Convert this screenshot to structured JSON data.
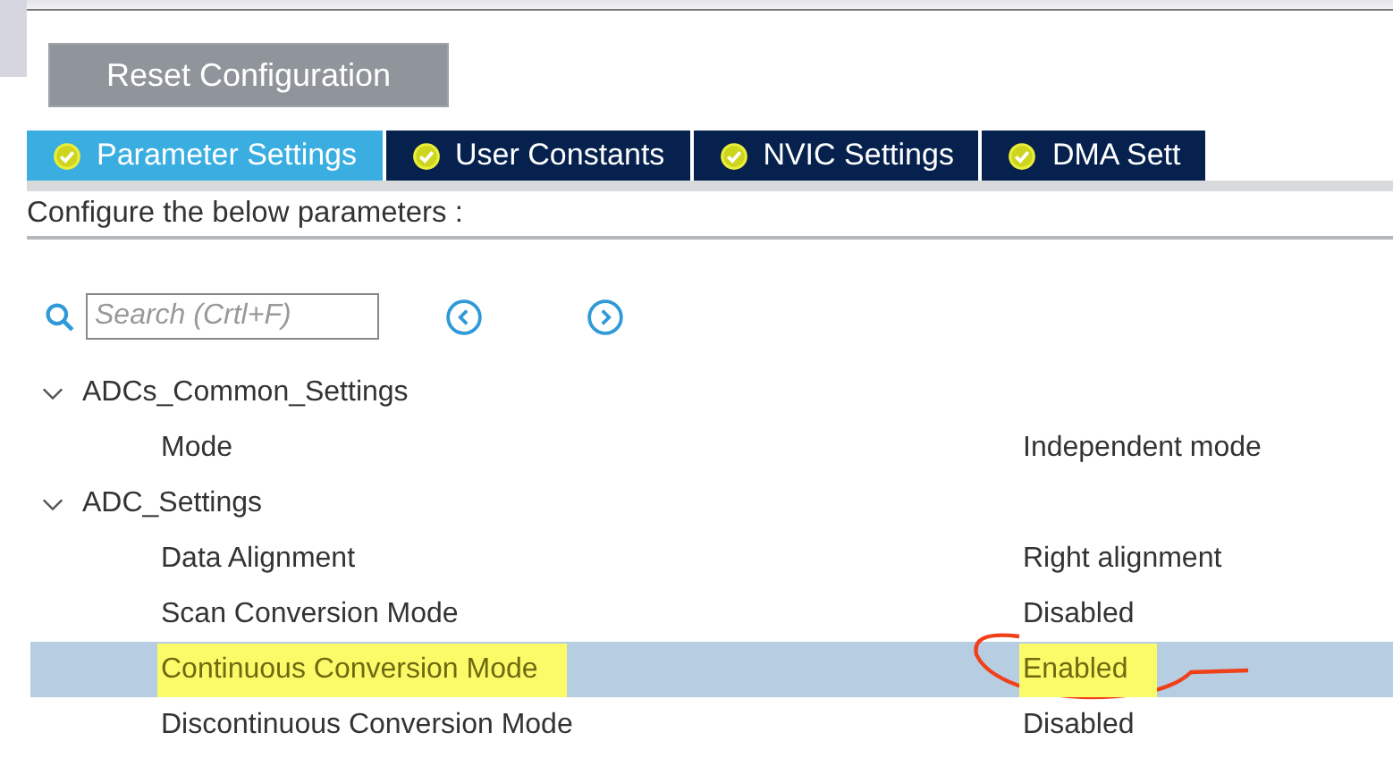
{
  "reset_button": {
    "label": "Reset Configuration"
  },
  "tabs": [
    {
      "label": "Parameter Settings",
      "selected": true
    },
    {
      "label": "User Constants",
      "selected": false
    },
    {
      "label": "NVIC Settings",
      "selected": false
    },
    {
      "label": "DMA Sett",
      "selected": false
    }
  ],
  "caption": "Configure the below parameters :",
  "search": {
    "placeholder": "Search (Crtl+F)"
  },
  "tree": [
    {
      "label": "ADCs_Common_Settings",
      "expanded": true,
      "children": [
        {
          "label": "Mode",
          "value": "Independent mode",
          "selected": false,
          "highlighted": false,
          "circled": false
        }
      ]
    },
    {
      "label": "ADC_Settings",
      "expanded": true,
      "children": [
        {
          "label": "Data Alignment",
          "value": "Right alignment",
          "selected": false,
          "highlighted": false,
          "circled": false
        },
        {
          "label": "Scan Conversion Mode",
          "value": "Disabled",
          "selected": false,
          "highlighted": false,
          "circled": false
        },
        {
          "label": "Continuous Conversion Mode",
          "value": "Enabled",
          "selected": true,
          "highlighted": true,
          "circled": true
        },
        {
          "label": "Discontinuous Conversion Mode",
          "value": "Disabled",
          "selected": false,
          "highlighted": false,
          "circled": false
        }
      ]
    }
  ]
}
